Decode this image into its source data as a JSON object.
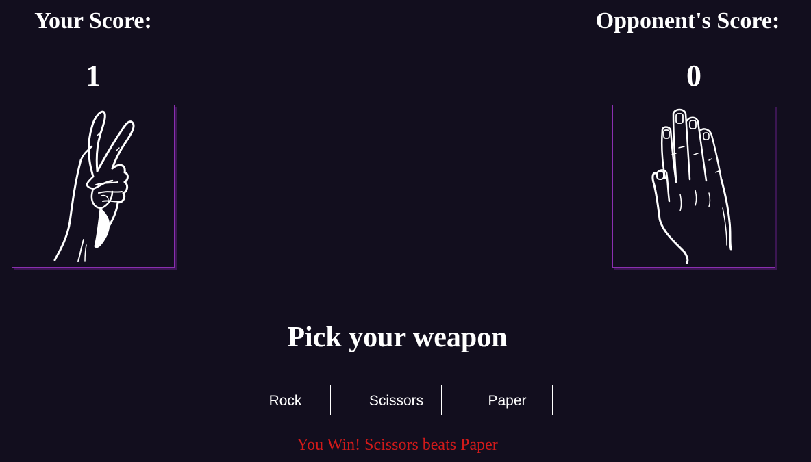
{
  "player": {
    "score_label": "Your Score:",
    "score": "1",
    "hand": "scissors-hand-icon"
  },
  "opponent": {
    "score_label": "Opponent's Score:",
    "score": "0",
    "hand": "paper-hand-icon"
  },
  "prompt": "Pick your weapon",
  "buttons": {
    "rock": "Rock",
    "scissors": "Scissors",
    "paper": "Paper"
  },
  "result": "You Win! Scissors beats Paper",
  "colors": {
    "background": "#120e1e",
    "box_border": "#8a2fb0",
    "result_text": "#d21a1a",
    "text": "#ffffff"
  }
}
